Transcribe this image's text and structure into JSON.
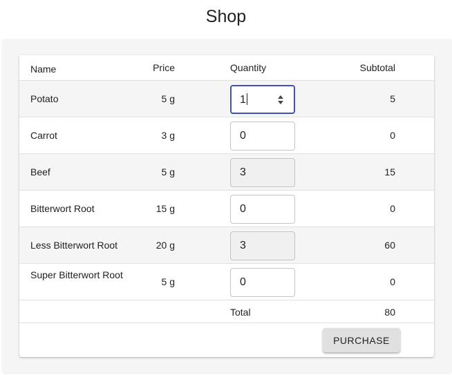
{
  "page": {
    "title": "Shop"
  },
  "table": {
    "headers": {
      "name": "Name",
      "price": "Price",
      "quantity": "Quantity",
      "subtotal": "Subtotal"
    },
    "rows": [
      {
        "name": "Potato",
        "price": "5 g",
        "quantity": "1",
        "subtotal": "5"
      },
      {
        "name": "Carrot",
        "price": "3 g",
        "quantity": "0",
        "subtotal": "0"
      },
      {
        "name": "Beef",
        "price": "5 g",
        "quantity": "3",
        "subtotal": "15"
      },
      {
        "name": "Bitterwort Root",
        "price": "15 g",
        "quantity": "0",
        "subtotal": "0"
      },
      {
        "name": "Less Bitterwort Root",
        "price": "20 g",
        "quantity": "3",
        "subtotal": "60"
      },
      {
        "name": "Super Bitterwort Root",
        "price": "5 g",
        "quantity": "0",
        "subtotal": "0"
      }
    ],
    "total_label": "Total",
    "total_value": "80"
  },
  "actions": {
    "purchase_label": "PURCHASE"
  },
  "colors": {
    "focus_border": "#3f51b5",
    "row_alt": "#f5f5f5",
    "button_bg": "#e0e0e0"
  }
}
